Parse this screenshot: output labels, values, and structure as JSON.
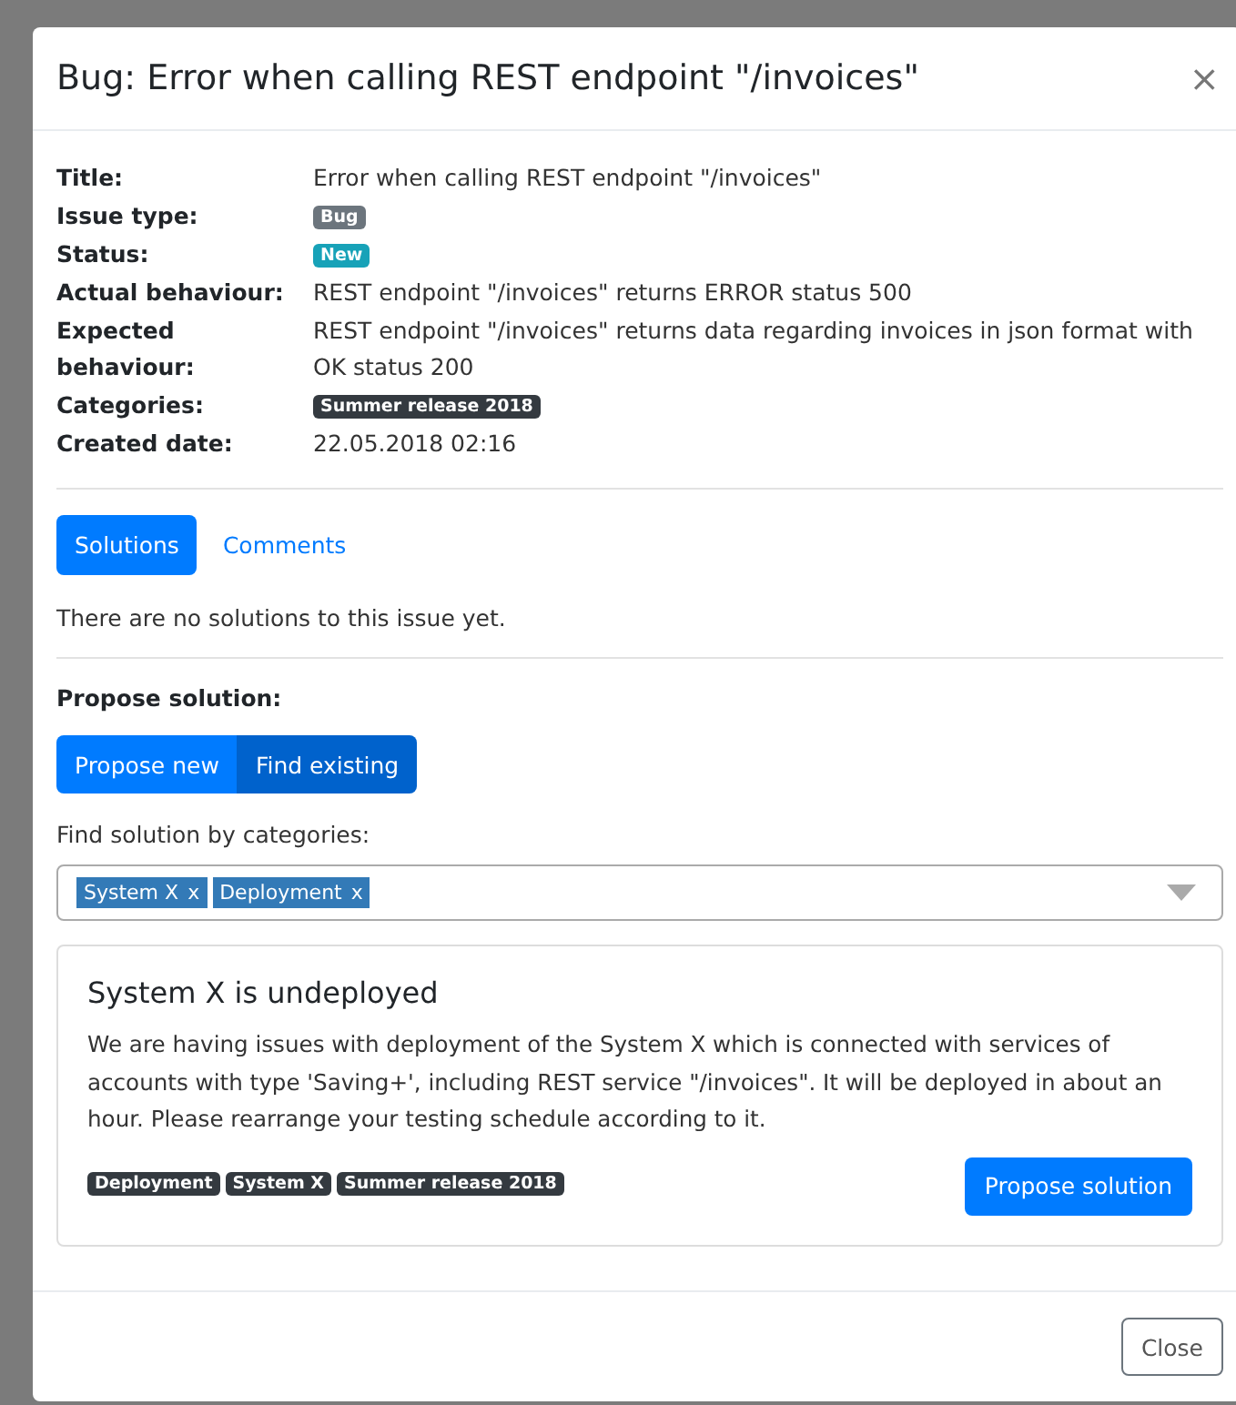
{
  "modal": {
    "title": "Bug: Error when calling REST endpoint \"/invoices\"",
    "close": "×"
  },
  "details": [
    {
      "label": "Title:",
      "kind": "text",
      "value": "Error when calling REST endpoint \"/invoices\""
    },
    {
      "label": "Issue type:",
      "kind": "badges",
      "badges": [
        {
          "text": "Bug",
          "color": "#6c757d"
        }
      ]
    },
    {
      "label": "Status:",
      "kind": "badges",
      "badges": [
        {
          "text": "New",
          "color": "#17a2b8"
        }
      ]
    },
    {
      "label": "Actual behaviour:",
      "kind": "text",
      "value": "REST endpoint \"/invoices\" returns ERROR status 500"
    },
    {
      "label": "Expected behaviour:",
      "kind": "text",
      "value": "REST endpoint \"/invoices\" returns data regarding invoices in json format with OK status 200"
    },
    {
      "label": "Categories:",
      "kind": "badges",
      "badges": [
        {
          "text": "Summer release 2018",
          "color": "#343a40"
        }
      ]
    },
    {
      "label": "Created date:",
      "kind": "text",
      "value": "22.05.2018 02:16"
    }
  ],
  "tabs": [
    {
      "label": "Solutions",
      "selected": true
    },
    {
      "label": "Comments",
      "selected": false
    }
  ],
  "tab_message": "There are no solutions to this issue yet.",
  "propose": {
    "heading": "Propose solution:",
    "modes": [
      {
        "label": "Propose new",
        "selected": false
      },
      {
        "label": "Find existing",
        "selected": true
      }
    ],
    "filter_label": "Find solution by categories:",
    "filter_chips": [
      {
        "text": "System X",
        "remove": "x"
      },
      {
        "text": "Deployment",
        "remove": "x"
      }
    ]
  },
  "solution_card": {
    "title": "System X is undeployed",
    "text": "We are having issues with deployment of the System X which is connected with services of accounts with type 'Saving+', including REST service \"/invoices\". It will be deployed in about an hour. Please rearrange your testing schedule according to it.",
    "tags": [
      "Deployment",
      "System X",
      "Summer release 2018"
    ],
    "button": "Propose solution"
  },
  "footer": {
    "button": "Close"
  }
}
